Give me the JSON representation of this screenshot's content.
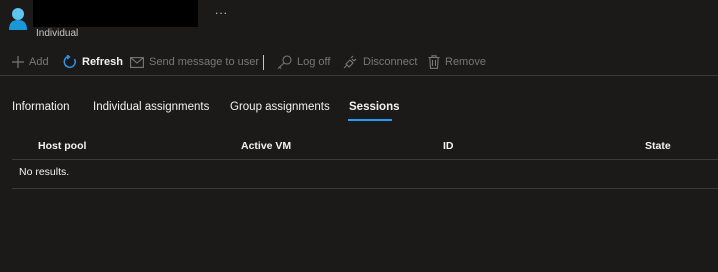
{
  "header": {
    "ellipsis": "...",
    "subtitle": "Individual"
  },
  "toolbar": {
    "add": "Add",
    "refresh": "Refresh",
    "send_message": "Send message to user",
    "log_off": "Log off",
    "disconnect": "Disconnect",
    "remove": "Remove"
  },
  "tabs": [
    {
      "label": "Information"
    },
    {
      "label": "Individual assignments"
    },
    {
      "label": "Group assignments"
    },
    {
      "label": "Sessions",
      "active": true
    }
  ],
  "table": {
    "columns": [
      "Host pool",
      "Active VM",
      "ID",
      "State"
    ],
    "empty_text": "No results."
  },
  "colors": {
    "background": "#1b1a19",
    "accent": "#2899f5",
    "disabled_text": "#797775"
  }
}
